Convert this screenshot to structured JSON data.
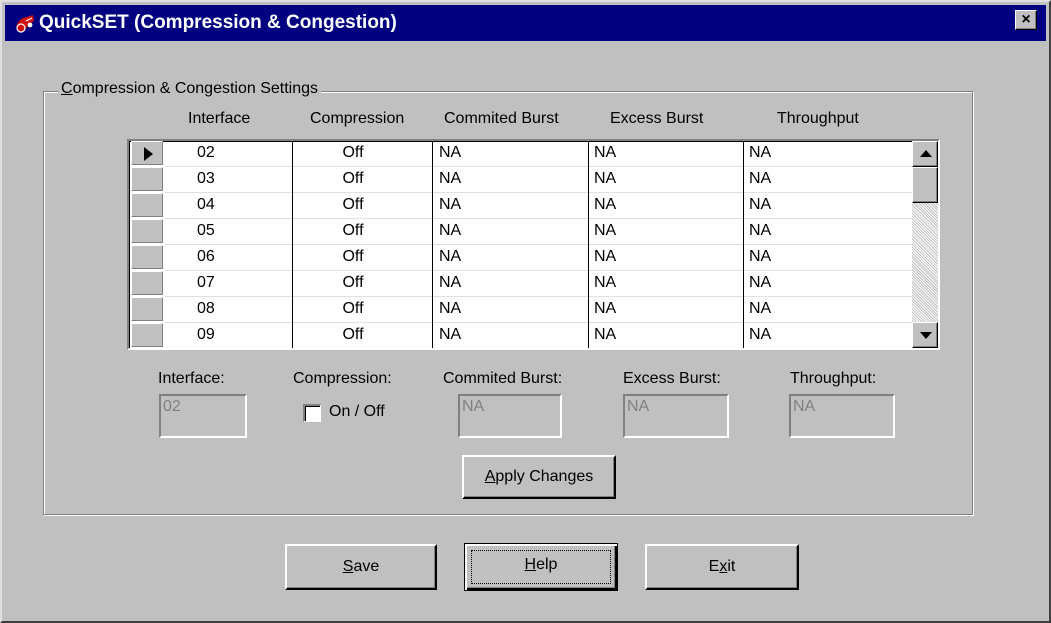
{
  "window": {
    "title": "QuickSET (Compression & Congestion)",
    "close_glyph": "×"
  },
  "group": {
    "legend_hotkey": "C",
    "legend_rest": "ompression & Congestion Settings"
  },
  "grid": {
    "columns": [
      "Interface",
      "Compression",
      "Commited Burst",
      "Excess Burst",
      "Throughput"
    ],
    "rows": [
      [
        "02",
        "Off",
        "NA",
        "NA",
        "NA"
      ],
      [
        "03",
        "Off",
        "NA",
        "NA",
        "NA"
      ],
      [
        "04",
        "Off",
        "NA",
        "NA",
        "NA"
      ],
      [
        "05",
        "Off",
        "NA",
        "NA",
        "NA"
      ],
      [
        "06",
        "Off",
        "NA",
        "NA",
        "NA"
      ],
      [
        "07",
        "Off",
        "NA",
        "NA",
        "NA"
      ],
      [
        "08",
        "Off",
        "NA",
        "NA",
        "NA"
      ],
      [
        "09",
        "Off",
        "NA",
        "NA",
        "NA"
      ]
    ],
    "selected_row": 0
  },
  "editor": {
    "interface_label": "Interface:",
    "interface_value": "02",
    "compression_label": "Compression:",
    "compression_toggle_label": "On / Off",
    "compression_checked": false,
    "committed_burst_label": "Commited Burst:",
    "committed_burst_value": "NA",
    "excess_burst_label": "Excess Burst:",
    "excess_burst_value": "NA",
    "throughput_label": "Throughput:",
    "throughput_value": "NA"
  },
  "buttons": {
    "apply_hotkey": "A",
    "apply_rest": "pply Changes",
    "save_hotkey": "S",
    "save_rest": "ave",
    "help_hotkey": "H",
    "help_rest": "elp",
    "exit_pre": "E",
    "exit_hotkey": "x",
    "exit_rest": "it"
  }
}
